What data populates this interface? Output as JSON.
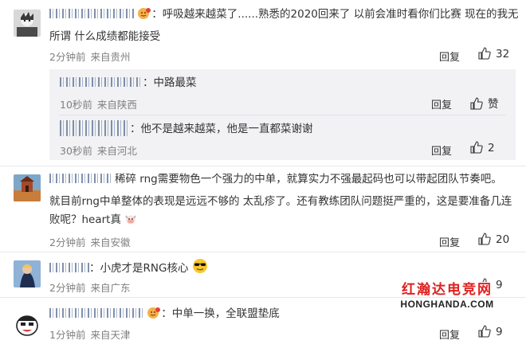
{
  "comments": [
    {
      "text_line1": "：呼吸越来越菜了......熟悉的2020回来了 以前会准时看你们比赛 现在的我无",
      "text_line2": "所谓 什么成绩都能接受",
      "time": "2分钟前",
      "location": "来自贵州",
      "reply_label": "回复",
      "likes": "32",
      "replies": [
        {
          "username": "SmoothFly1314",
          "text": "：中路最菜",
          "time": "10秒前",
          "location": "来自陕西",
          "reply_label": "回复",
          "likes": "赞"
        },
        {
          "text": "：他不是越来越菜，他是一直都菜谢谢",
          "time": "30秒前",
          "location": "来自河北",
          "reply_label": "回复",
          "likes": "2"
        }
      ]
    },
    {
      "username": "mlandWMn",
      "text_line1": "稀碎 rng需要物色一个强力的中单，就算实力不强最起码也可以带起团队节奏吧。",
      "text_line2": "就目前rng中单整体的表现是远远不够的 太乱疹了。还有教练团队问题挺严重的，这是要准备几连",
      "text_line3": "败呢？heart真",
      "time": "2分钟前",
      "location": "来自安徽",
      "reply_label": "回复",
      "likes": "20"
    },
    {
      "username": "_Wind",
      "text": "：小虎才是RNG核心",
      "time": "2分钟前",
      "location": "来自广东",
      "reply_label": "回复",
      "likes": "9"
    },
    {
      "text": "：中单一换，全联盟垫底",
      "time": "1分钟前",
      "location": "来自天津",
      "reply_label": "回复",
      "likes": "9"
    }
  ],
  "watermark": {
    "cn": "红瀚达电竞网",
    "en": "HONGHANDA.COM"
  },
  "colors": {
    "text": "#333333",
    "meta": "#808080",
    "reply_bg": "#f2f2f5",
    "watermark_red": "#e02020"
  }
}
